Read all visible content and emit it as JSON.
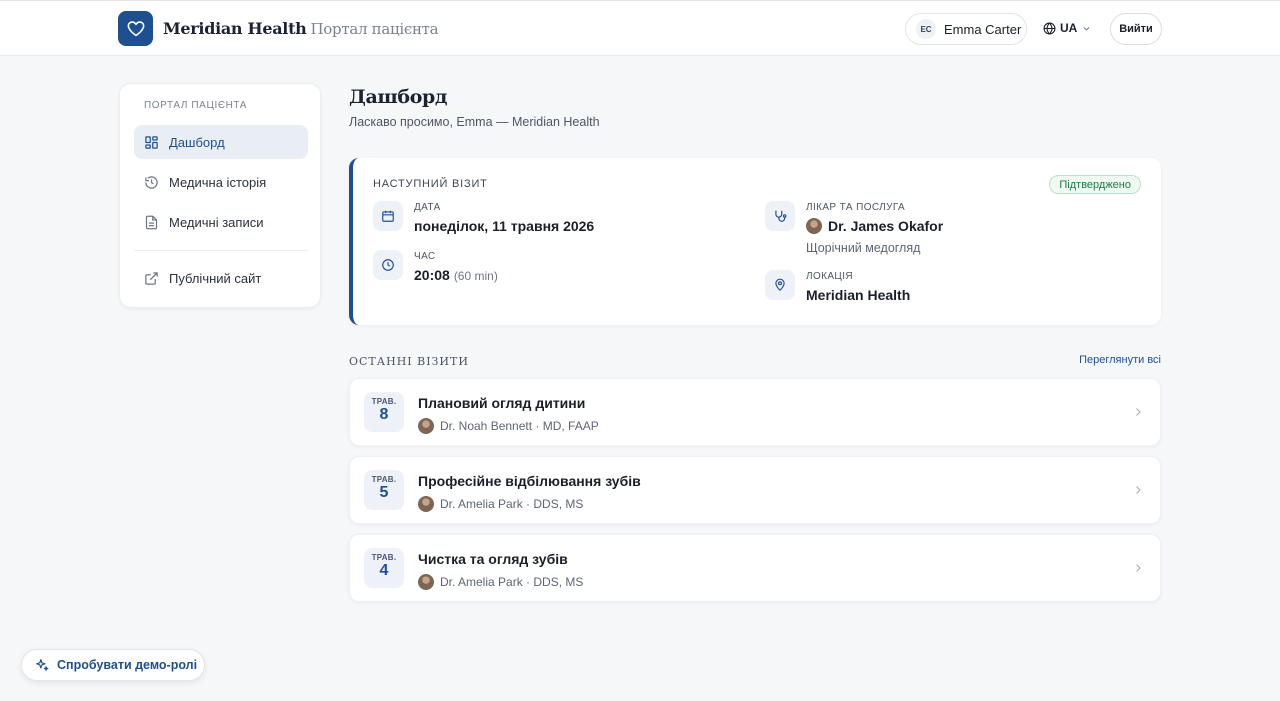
{
  "header": {
    "brand_name": "Meridian Health",
    "brand_sub": "Портал пацієнта",
    "user_initials": "EC",
    "user_name": "Emma Carter",
    "language": "UA",
    "logout_label": "Вийти"
  },
  "sidebar": {
    "section_title": "ПОРТАЛ ПАЦІЄНТА",
    "items": [
      {
        "label": "Дашборд",
        "icon": "dashboard-grid-icon",
        "active": true
      },
      {
        "label": "Медична історія",
        "icon": "history-icon",
        "active": false
      },
      {
        "label": "Медичні записи",
        "icon": "document-icon",
        "active": false
      },
      {
        "label": "Публічний сайт",
        "icon": "external-link-icon",
        "active": false
      }
    ]
  },
  "main": {
    "title": "Дашборд",
    "subtitle": "Ласкаво просимо, Emma — Meridian Health",
    "next_visit": {
      "label": "НАСТУПНИЙ ВІЗИТ",
      "status": "Підтверджено",
      "date_label": "ДАТА",
      "date_value": "понеділок, 11 травня 2026",
      "time_label": "ЧАС",
      "time_value": "20:08",
      "duration": "(60 min)",
      "doctor_label": "ЛІКАР ТА ПОСЛУГА",
      "doctor_name": "Dr. James Okafor",
      "service": "Щорічний медогляд",
      "location_label": "ЛОКАЦІЯ",
      "location_value": "Meridian Health"
    },
    "recent": {
      "title": "ОСТАННІ ВІЗИТИ",
      "view_all": "Переглянути всі",
      "visits": [
        {
          "month": "ТРАВ.",
          "day": "8",
          "title": "Плановий огляд дитини",
          "doctor": "Dr. Noah Bennett · MD, FAAP"
        },
        {
          "month": "ТРАВ.",
          "day": "5",
          "title": "Професійне відбілювання зубів",
          "doctor": "Dr. Amelia Park · DDS, MS"
        },
        {
          "month": "ТРАВ.",
          "day": "4",
          "title": "Чистка та огляд зубів",
          "doctor": "Dr. Amelia Park · DDS, MS"
        }
      ]
    }
  },
  "demo_button": "Спробувати демо-ролі",
  "colors": {
    "brand": "#1e4f91",
    "background": "#f6f7f8",
    "status_green": "#1d7a46"
  }
}
